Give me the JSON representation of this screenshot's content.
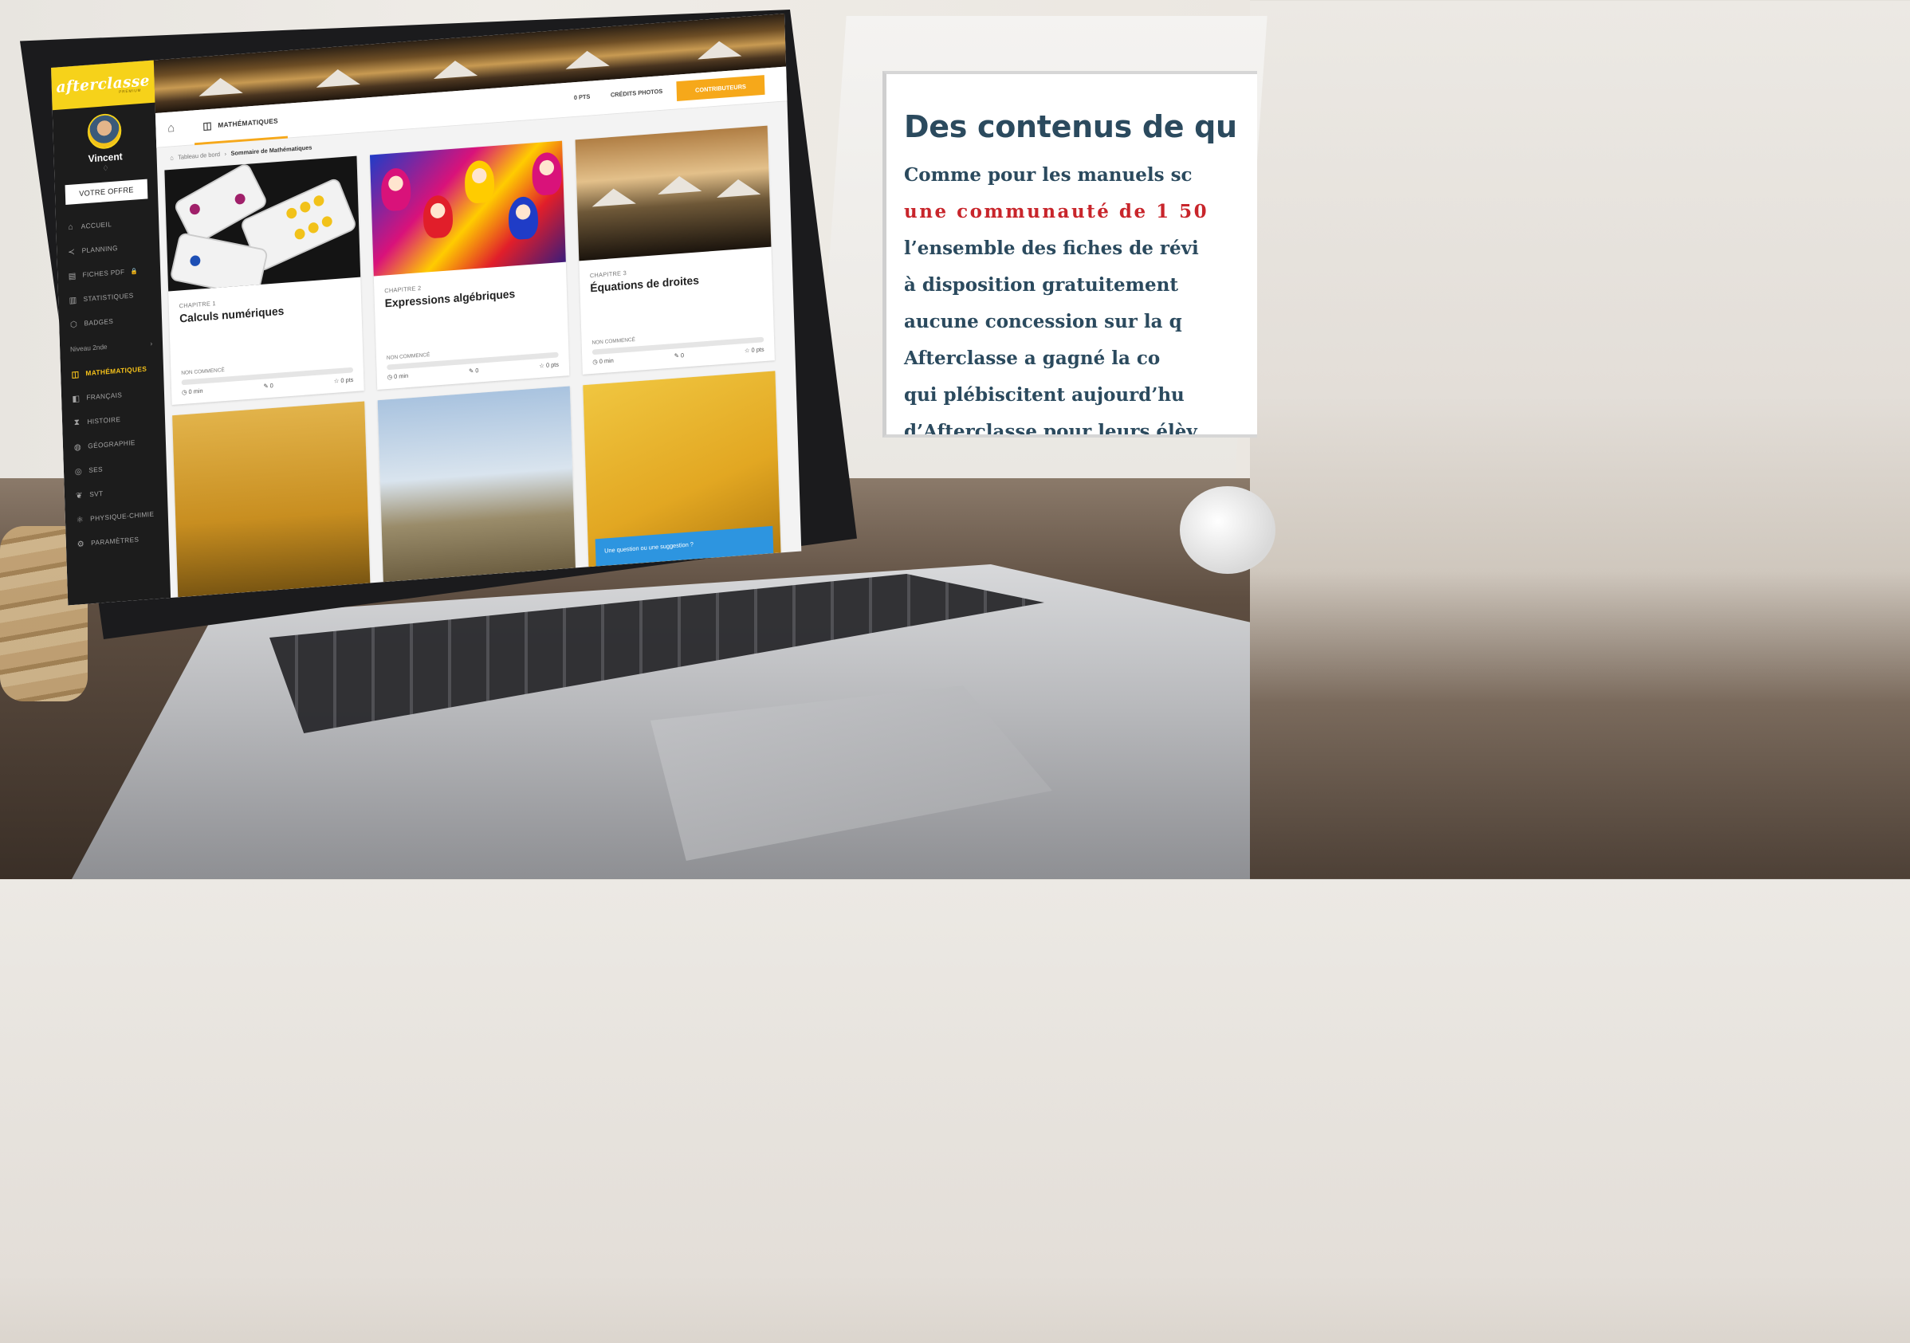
{
  "app": {
    "logo_text": "afterclasse",
    "logo_sub": "PREMIUM"
  },
  "user": {
    "name": "Vincent",
    "gem": "♢"
  },
  "sidebar": {
    "offer_label": "VOTRE OFFRE",
    "items": [
      {
        "label": "ACCUEIL",
        "icon": "home-icon"
      },
      {
        "label": "PLANNING",
        "icon": "share-icon"
      },
      {
        "label": "FICHES PDF",
        "icon": "document-icon",
        "lock": "🔒"
      },
      {
        "label": "STATISTIQUES",
        "icon": "chart-icon"
      },
      {
        "label": "BADGES",
        "icon": "shield-icon"
      }
    ],
    "level_label": "Niveau 2nde",
    "level_arrow": "›",
    "subjects": [
      {
        "label": "MATHÉMATIQUES",
        "icon": "math-icon",
        "active": true
      },
      {
        "label": "FRANÇAIS",
        "icon": "book-icon",
        "active": false
      },
      {
        "label": "HISTOIRE",
        "icon": "hourglass-icon",
        "active": false
      },
      {
        "label": "GÉOGRAPHIE",
        "icon": "globe-icon",
        "active": false
      },
      {
        "label": "SES",
        "icon": "coins-icon",
        "active": false
      },
      {
        "label": "SVT",
        "icon": "leaf-icon",
        "active": false
      },
      {
        "label": "PHYSIQUE-CHIMIE",
        "icon": "atom-icon",
        "active": false
      },
      {
        "label": "PARAMÈTRES",
        "icon": "gear-icon",
        "active": false
      }
    ]
  },
  "topbar": {
    "subject_tab": "MATHÉMATIQUES",
    "points": "0 PTS",
    "credits": "CRÉDITS PHOTOS",
    "contribute": "CONTRIBUTEURS"
  },
  "breadcrumb": {
    "home": "Tableau de bord",
    "separator": "›",
    "current": "Sommaire de Mathématiques"
  },
  "chapters": [
    {
      "chapter": "CHAPITRE 1",
      "title": "Calculs numériques",
      "status": "NON COMMENCÉ",
      "progress": 0,
      "time": "0 min",
      "edits": "0",
      "points": "0 pts"
    },
    {
      "chapter": "CHAPITRE 2",
      "title": "Expressions algébriques",
      "status": "NON COMMENCÉ",
      "progress": 0,
      "time": "0 min",
      "edits": "0",
      "points": "0 pts"
    },
    {
      "chapter": "CHAPITRE 3",
      "title": "Équations de droites",
      "status": "NON COMMENCÉ",
      "progress": 0,
      "time": "0 min",
      "edits": "0",
      "points": "0 pts"
    }
  ],
  "suggestion": "Une question ou une suggestion ?",
  "overlay": {
    "title": "Des contenus de qu",
    "lines": [
      {
        "text": "Comme pour les manuels sc",
        "highlight": false
      },
      {
        "text": "une communauté de 1 50",
        "highlight": true
      },
      {
        "text": "l’ensemble des fiches de révi",
        "highlight": false
      },
      {
        "text": "à disposition gratuitement",
        "highlight": false
      },
      {
        "text": "aucune concession sur la q",
        "highlight": false
      },
      {
        "text": "Afterclasse a gagné la co",
        "highlight": false
      },
      {
        "text": "qui plébiscitent aujourd’hu",
        "highlight": false
      },
      {
        "text": "d’Afterclasse pour leurs élèv",
        "highlight": false
      }
    ]
  },
  "colors": {
    "brand_yellow": "#f6d21a",
    "accent_orange": "#f6a81a",
    "sidebar_bg": "#1c1c1c",
    "overlay_text": "#2b4a5e",
    "overlay_highlight": "#c8252b"
  }
}
